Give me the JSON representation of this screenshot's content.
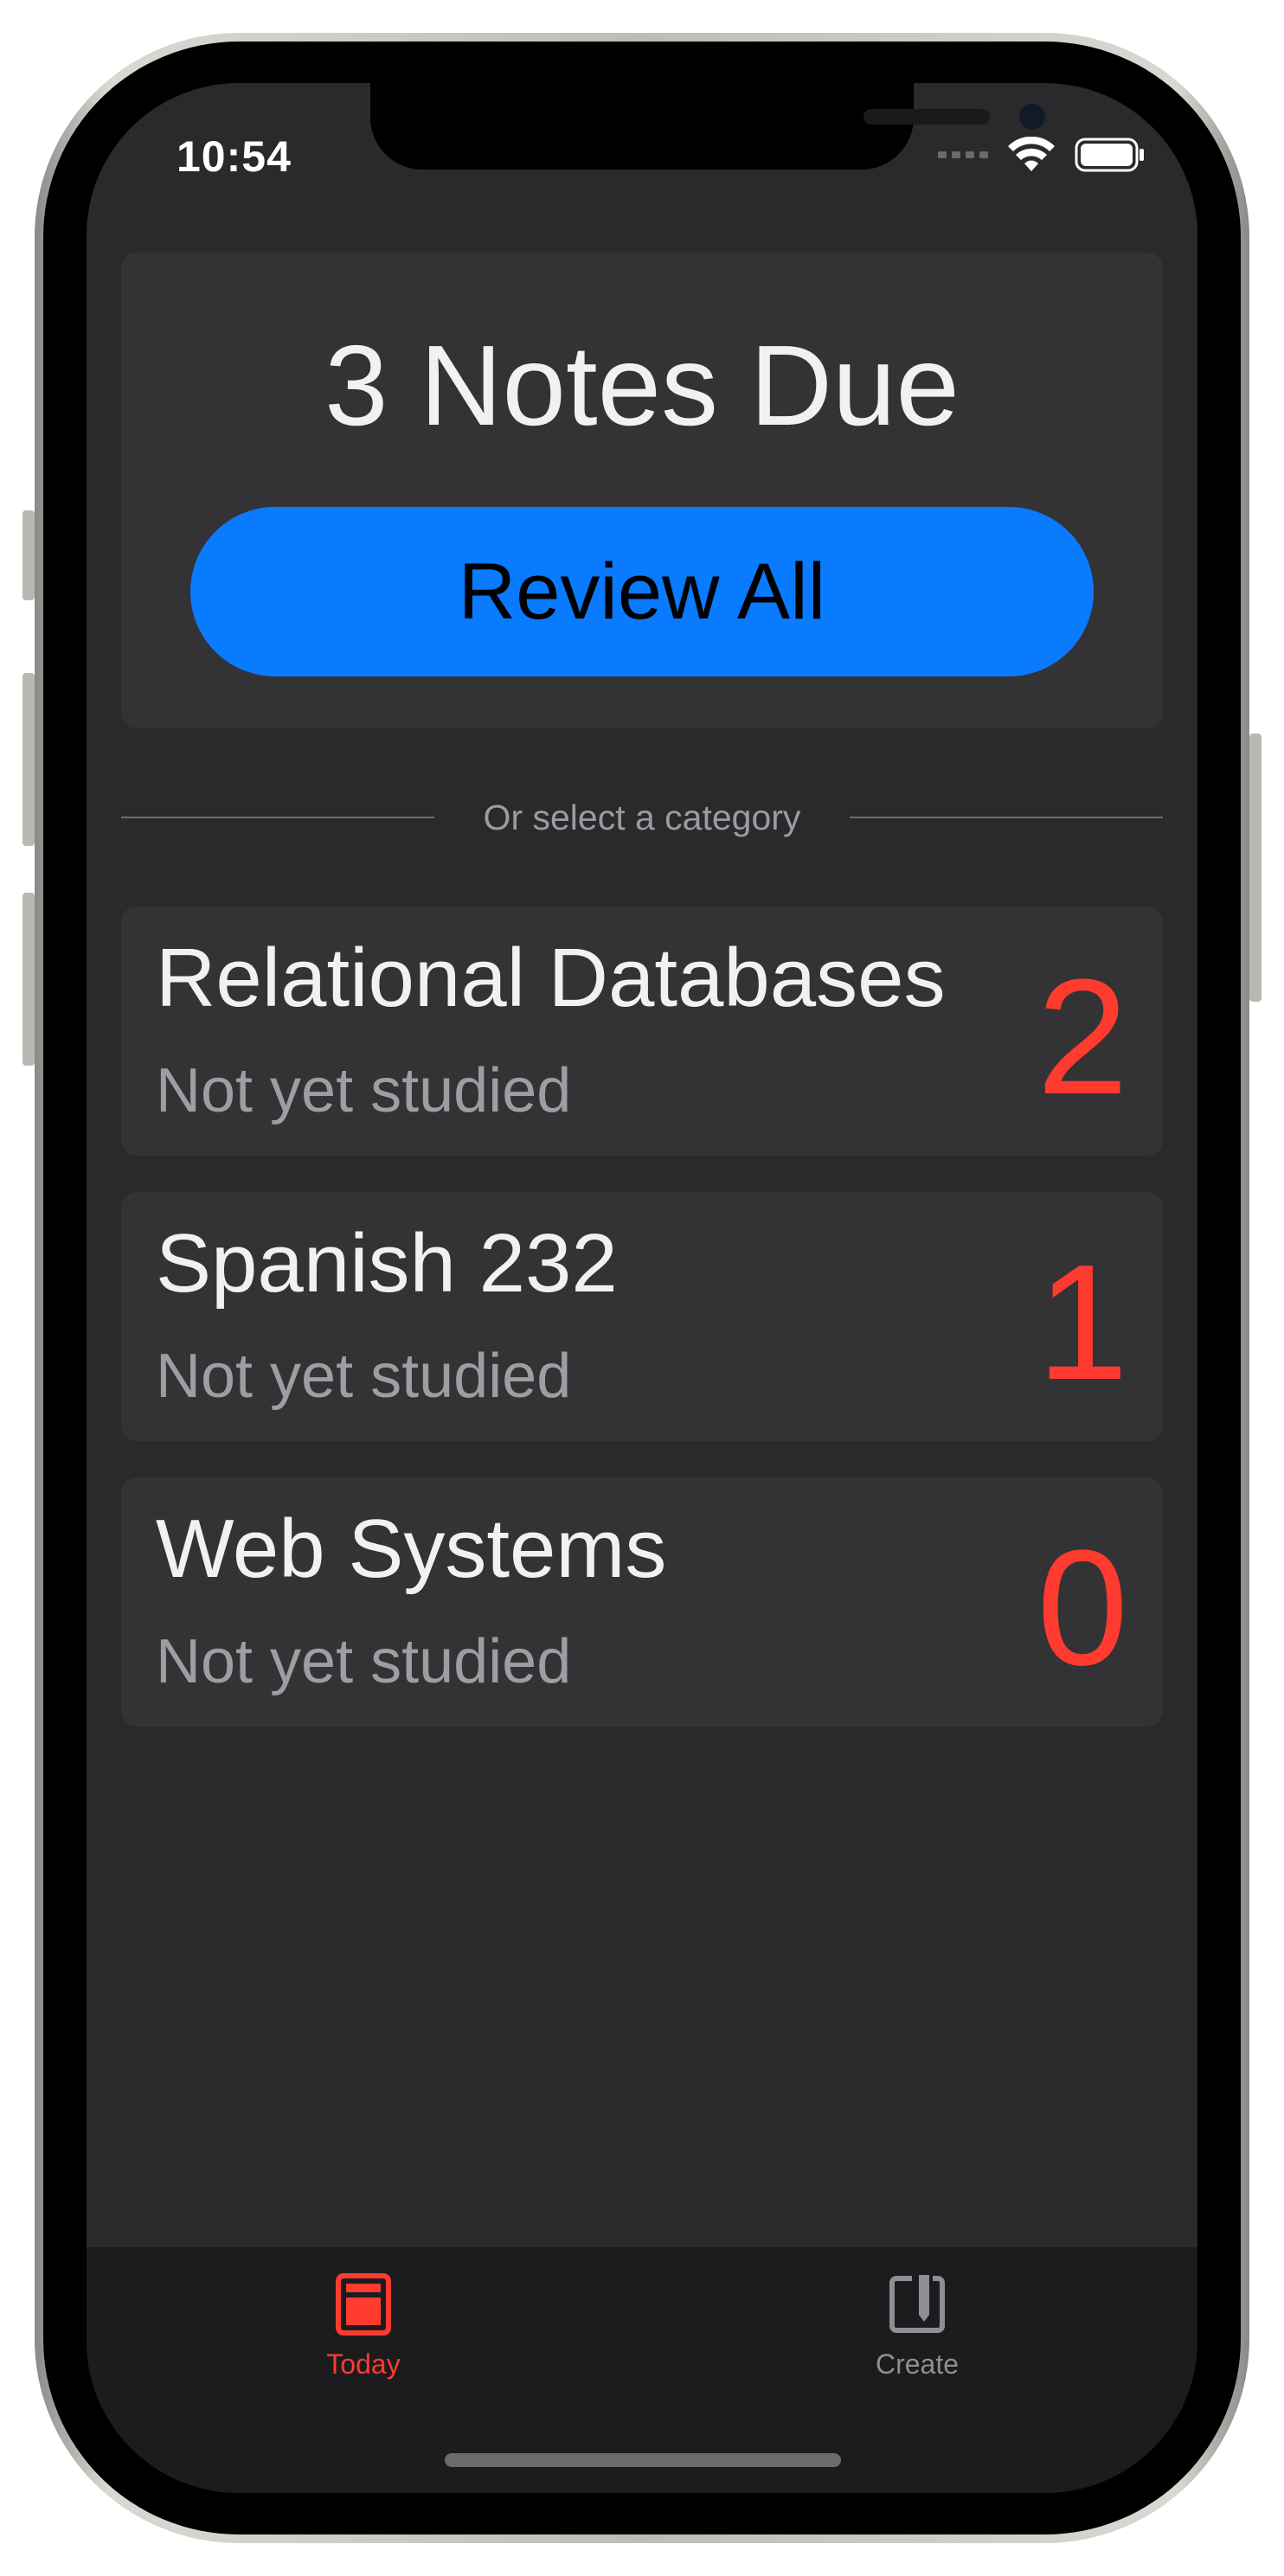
{
  "status_bar": {
    "time": "10:54"
  },
  "summary": {
    "title": "3 Notes Due",
    "review_button_label": "Review All"
  },
  "divider": {
    "label": "Or select a category"
  },
  "categories": [
    {
      "name": "Relational Databases",
      "status": "Not yet studied",
      "count": "2"
    },
    {
      "name": "Spanish 232",
      "status": "Not yet studied",
      "count": "1"
    },
    {
      "name": "Web Systems",
      "status": "Not yet studied",
      "count": "0"
    }
  ],
  "tab_bar": {
    "tabs": [
      {
        "label": "Today",
        "icon": "today-icon",
        "active": true
      },
      {
        "label": "Create",
        "icon": "create-icon",
        "active": false
      }
    ]
  },
  "colors": {
    "accent_blue": "#0A7AFF",
    "count_red": "#FF3B30",
    "background": "#2A292B",
    "card": "#333234",
    "tab_bar": "#1C1C1E"
  }
}
